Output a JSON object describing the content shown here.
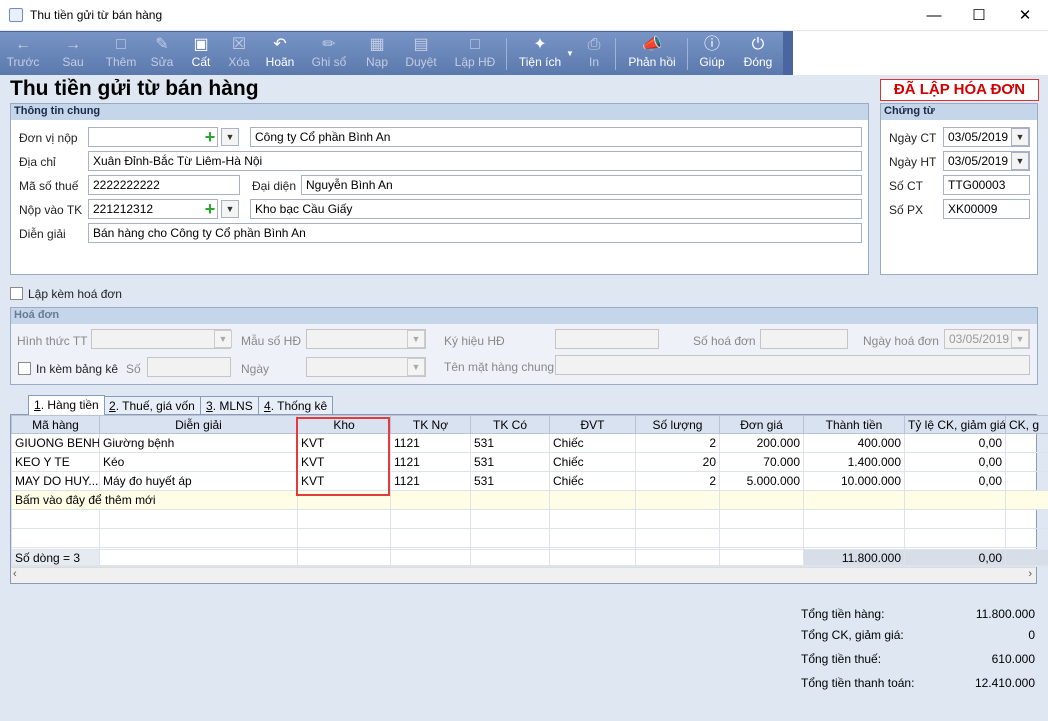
{
  "window": {
    "title": "Thu tiền gửi từ bán hàng"
  },
  "toolbar": {
    "back": "Trước",
    "next": "Sau",
    "add": "Thêm",
    "edit": "Sửa",
    "save": "Cất",
    "delete": "Xóa",
    "undo": "Hoãn",
    "post": "Ghi sổ",
    "load": "Nạp",
    "approve": "Duyệt",
    "invoice": "Lập HĐ",
    "utilities": "Tiện ích",
    "print": "In",
    "feedback": "Phản hồi",
    "help": "Giúp",
    "close": "Đóng"
  },
  "page": {
    "title": "Thu tiền gửi từ bán hàng",
    "status": "ĐÃ LẬP HÓA ĐƠN"
  },
  "general": {
    "header": "Thông tin chung",
    "payer_label": "Đơn vị nộp",
    "payer_code": "",
    "payer_name": "Công ty Cổ phần Bình An",
    "address_label": "Địa chỉ",
    "address": "Xuân Đỉnh-Bắc Từ Liêm-Hà Nội",
    "tax_label": "Mã số thuế",
    "tax": "2222222222",
    "rep_label": "Đại diện",
    "rep": "Nguyễn Bình An",
    "account_label": "Nộp vào TK",
    "account": "221212312",
    "bank": "Kho bạc Cầu Giấy",
    "desc_label": "Diễn giải",
    "desc": "Bán hàng cho Công ty Cổ phần Bình An"
  },
  "voucher": {
    "header": "Chứng từ",
    "date_ct_label": "Ngày CT",
    "date_ct": "03/05/2019",
    "date_ht_label": "Ngày HT",
    "date_ht": "03/05/2019",
    "so_ct_label": "Số CT",
    "so_ct": "TTG00003",
    "so_px_label": "Số PX",
    "so_px": "XK00009"
  },
  "attach_invoice_label": "Lập kèm hoá đơn",
  "invoice": {
    "header": "Hoá đơn",
    "pay_method_label": "Hình thức TT",
    "template_label": "Mẫu số HĐ",
    "symbol_label": "Ký hiệu HĐ",
    "number_label": "Số hoá đơn",
    "date_label": "Ngày hoá đơn",
    "date": "03/05/2019",
    "print_list_label": "In kèm bảng kê",
    "list_no_label": "Số",
    "list_date_label": "Ngày",
    "common_name_label": "Tên mặt hàng chung"
  },
  "tabs": [
    {
      "num": "1",
      "label": ". Hàng tiền"
    },
    {
      "num": "2",
      "label": ". Thuế, giá vốn"
    },
    {
      "num": "3",
      "label": ". MLNS"
    },
    {
      "num": "4",
      "label": ". Thống kê"
    }
  ],
  "grid": {
    "columns": [
      "Mã hàng",
      "Diễn giải",
      "Kho",
      "TK Nợ",
      "TK Có",
      "ĐVT",
      "Số lượng",
      "Đơn giá",
      "Thành tiền",
      "Tỷ lệ CK, giảm giá",
      "CK, g"
    ],
    "rows": [
      {
        "code": "GIUONG BENH",
        "desc": "Giường bệnh",
        "kho": "KVT",
        "tk_no": "1121",
        "tk_co": "531",
        "unit": "Chiếc",
        "qty": "2",
        "price": "200.000",
        "amount": "400.000",
        "disc": "0,00"
      },
      {
        "code": "KEO Y TE",
        "desc": "Kéo",
        "kho": "KVT",
        "tk_no": "1121",
        "tk_co": "531",
        "unit": "Chiếc",
        "qty": "20",
        "price": "70.000",
        "amount": "1.400.000",
        "disc": "0,00"
      },
      {
        "code": "MAY DO HUY...",
        "desc": "Máy đo huyết áp",
        "kho": "KVT",
        "tk_no": "1121",
        "tk_co": "531",
        "unit": "Chiếc",
        "qty": "2",
        "price": "5.000.000",
        "amount": "10.000.000",
        "disc": "0,00"
      }
    ],
    "new_row_hint": "Bấm vào đây để thêm mới",
    "row_count": "Số dòng = 3",
    "total_amount": "11.800.000",
    "total_disc": "0,00"
  },
  "totals": {
    "goods_label": "Tổng tiền hàng:",
    "goods": "11.800.000",
    "discount_label": "Tổng CK, giảm giá:",
    "discount": "0",
    "tax_label": "Tổng tiền thuế:",
    "tax": "610.000",
    "pay_label": "Tổng tiền thanh toán:",
    "pay": "12.410.000"
  }
}
